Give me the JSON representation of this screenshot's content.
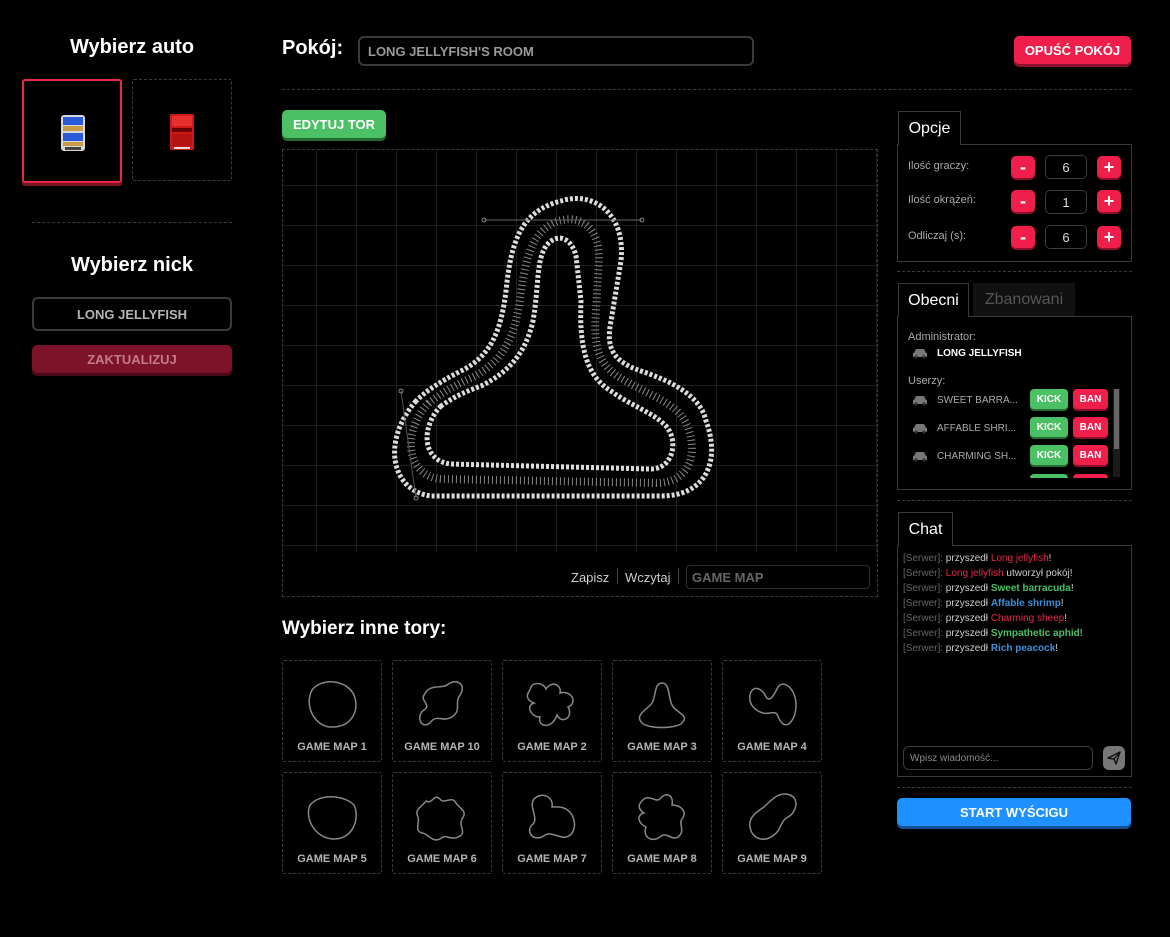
{
  "left": {
    "car_heading": "Wybierz auto",
    "nick_heading": "Wybierz nick",
    "nick_value": "LONG JELLYFISH",
    "update_label": "ZAKTUALIZUJ",
    "cars": [
      {
        "icon": "police-car-icon",
        "selected": true
      },
      {
        "icon": "red-truck-icon",
        "selected": false
      }
    ]
  },
  "top": {
    "room_label": "Pokój:",
    "room_value": "LONG JELLYFISH'S ROOM",
    "leave_label": "OPUŚĆ POKÓJ"
  },
  "editor": {
    "edit_label": "EDYTUJ TOR",
    "save_label": "Zapisz",
    "load_label": "Wczytaj",
    "map_name_placeholder": "GAME MAP"
  },
  "maps": {
    "heading": "Wybierz inne tory:",
    "items": [
      "GAME MAP 1",
      "GAME MAP 10",
      "GAME MAP 2",
      "GAME MAP 3",
      "GAME MAP 4",
      "GAME MAP 5",
      "GAME MAP 6",
      "GAME MAP 7",
      "GAME MAP 8",
      "GAME MAP 9"
    ]
  },
  "options": {
    "tab_label": "Opcje",
    "players_label": "Ilość graczy:",
    "players_value": "6",
    "laps_label": "Ilość okrążeń:",
    "laps_value": "1",
    "countdown_label": "Odliczaj (s):",
    "countdown_value": "6",
    "minus": "-",
    "plus": "+"
  },
  "people": {
    "tab_present": "Obecni",
    "tab_banned": "Zbanowani",
    "admin_label": "Administrator:",
    "admin_name": "LONG JELLYFISH",
    "users_label": "Userzy:",
    "kick_label": "KICK",
    "ban_label": "BAN",
    "users": [
      "SWEET BARRA...",
      "AFFABLE SHRI...",
      "CHARMING SH..."
    ]
  },
  "chat": {
    "tab_label": "Chat",
    "server_tag": "[Serwer]:",
    "messages": [
      {
        "pre": "przyszedł ",
        "name": "Long jellyfish",
        "post": "!",
        "color": "#e8274d"
      },
      {
        "pre": "",
        "name": "Long jellyfish",
        "post": " utworzył pokój!",
        "color": "#e8274d"
      },
      {
        "pre": "przyszedł ",
        "name": "Sweet barracuda",
        "post": "!",
        "color": "#4cc064"
      },
      {
        "pre": "przyszedł ",
        "name": "Affable shrimp",
        "post": "!",
        "color": "#3a8fd8"
      },
      {
        "pre": "przyszedł ",
        "name": "Charming sheep",
        "post": "!",
        "color": "#e8274d"
      },
      {
        "pre": "przyszedł ",
        "name": "Sympathetic aphid",
        "post": "!",
        "color": "#4cc064"
      },
      {
        "pre": "przyszedł ",
        "name": "Rich peacock",
        "post": "!",
        "color": "#3a8fd8"
      }
    ],
    "input_placeholder": "Wpisz wiadomość...",
    "send_icon": "send-icon"
  },
  "start_label": "START WYŚCIGU",
  "colors": {
    "accent_red": "#f01e4b",
    "green": "#4cc064",
    "blue": "#1e90ff"
  }
}
